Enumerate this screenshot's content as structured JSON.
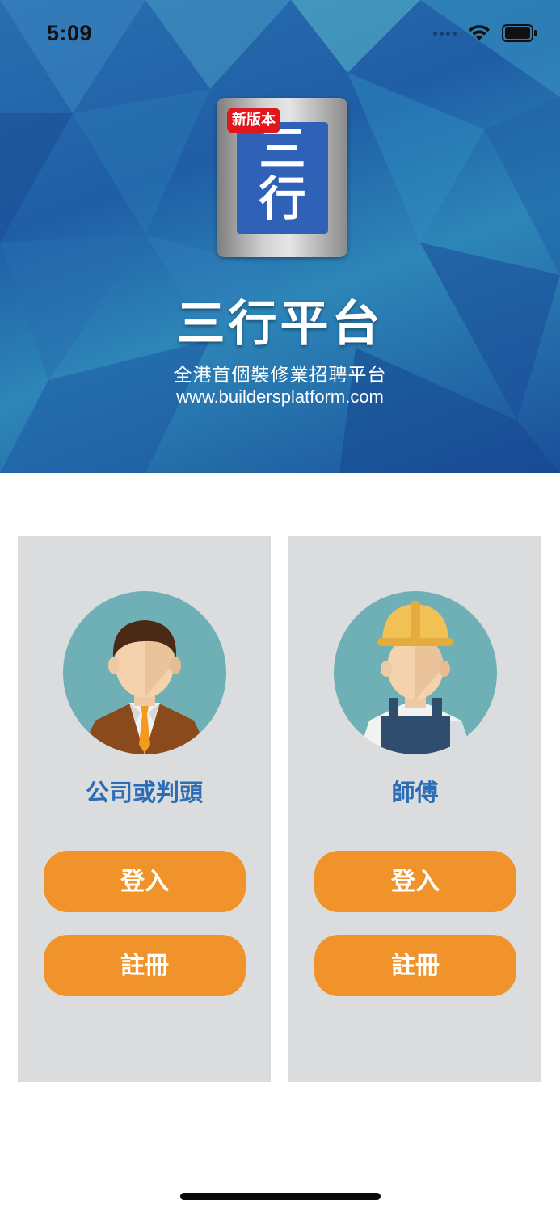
{
  "status_bar": {
    "time": "5:09"
  },
  "banner": {
    "badge": "新版本",
    "logo_chars": [
      "三",
      "行"
    ],
    "title": "三行平台",
    "subtitle": "全港首個裝修業招聘平台",
    "url": "www.buildersplatform.com"
  },
  "cards": [
    {
      "role": "公司或判頭",
      "login_label": "登入",
      "register_label": "註冊"
    },
    {
      "role": "師傅",
      "login_label": "登入",
      "register_label": "註冊"
    }
  ],
  "colors": {
    "accent": "#f0932a",
    "role_text": "#2d6db5",
    "card_bg": "#dbdcde",
    "badge": "#e0171c"
  }
}
